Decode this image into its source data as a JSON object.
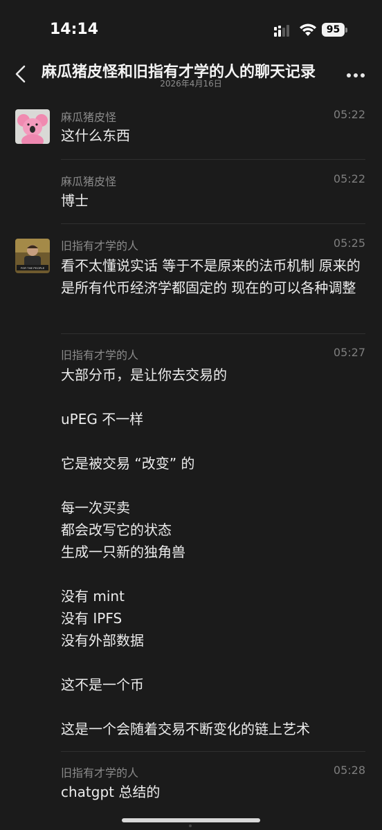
{
  "status": {
    "time": "14:14",
    "battery": "95"
  },
  "nav": {
    "title": "麻瓜猪皮怪和旧指有才学的人的聊天记录",
    "date": "2026年4月16日"
  },
  "messages": [
    {
      "sender": "麻瓜猪皮怪",
      "time": "05:22",
      "text": "这什么东西"
    },
    {
      "sender": "麻瓜猪皮怪",
      "time": "05:22",
      "text": "博士"
    },
    {
      "sender": "旧指有才学的人",
      "time": "05:25",
      "text": "看不太懂说实话 等于不是原来的法币机制 原来的是所有代币经济学都固定的 现在的可以各种调整",
      "avatar_caption": "FOR THE PEOPLE"
    },
    {
      "sender": "旧指有才学的人",
      "time": "05:27",
      "text": "大部分币，是让你去交易的\n\nuPEG 不一样\n\n它是被交易 “改变” 的\n\n每一次买卖\n都会改写它的状态\n生成一只新的独角兽\n\n没有 mint\n没有 IPFS\n没有外部数据\n\n这不是一个币\n\n这是一个会随着交易不断变化的链上艺术"
    },
    {
      "sender": "旧指有才学的人",
      "time": "05:28",
      "text": "chatgpt 总结的"
    }
  ]
}
